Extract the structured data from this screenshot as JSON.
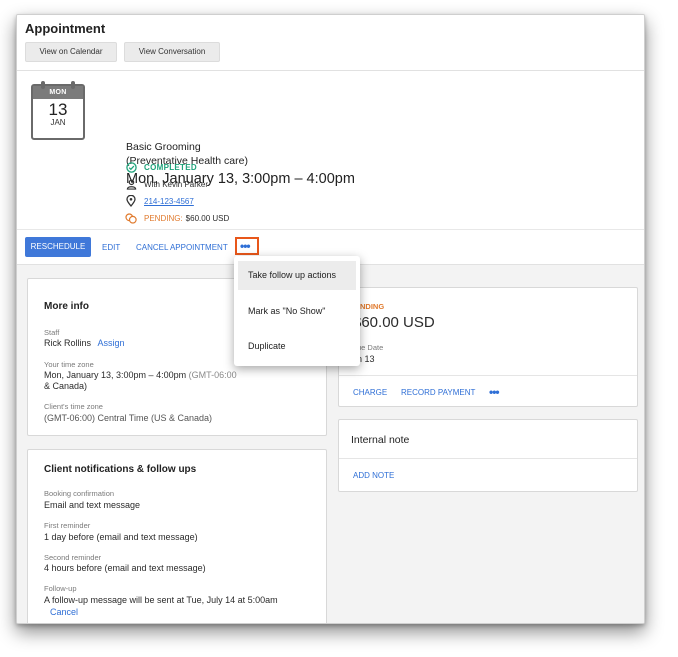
{
  "header": {
    "title": "Appointment",
    "view_calendar": "View on Calendar",
    "view_conversation": "View Conversation"
  },
  "calendar_icon": {
    "weekday": "MON",
    "day": "13",
    "month": "JAN"
  },
  "summary": {
    "service_line1": "Basic Grooming",
    "service_line2": "(Preventative Health care)",
    "datetime": "Mon, January 13, 3:00pm – 4:00pm",
    "status": "COMPLETED",
    "staff": "With Kevin Parker",
    "phone": "214-123-4567",
    "payment_status": "PENDING:",
    "payment_amount": "$60.00 USD"
  },
  "actions": {
    "reschedule": "RESCHEDULE",
    "edit": "EDIT",
    "cancel": "CANCEL APPOINTMENT",
    "more": "•••"
  },
  "more_menu": {
    "items": [
      "Take follow up actions",
      "Mark as \"No Show\"",
      "Duplicate"
    ]
  },
  "more_info": {
    "title": "More info",
    "staff_label": "Staff",
    "staff_value": "Rick Rollins",
    "assign": "Assign",
    "your_tz_label": "Your time zone",
    "your_tz_value": "Mon, January 13, 3:00pm – 4:00pm",
    "your_tz_zone_a": "(GMT-06:00",
    "your_tz_zone_b": "& Canada)",
    "client_tz_label": "Client's time zone",
    "client_tz_value": "(GMT-06:00) Central Time (US & Canada)"
  },
  "notifications": {
    "title": "Client notifications & follow ups",
    "booking_label": "Booking confirmation",
    "booking_value": "Email and text message",
    "first_label": "First reminder",
    "first_value": "1 day before (email and text message)",
    "second_label": "Second reminder",
    "second_value": "4 hours before (email and text message)",
    "followup_label": "Follow-up",
    "followup_value": "A follow-up message will be sent at Tue, July 14 at 5:00am",
    "cancel": "Cancel"
  },
  "payment_card": {
    "status": "ENDING",
    "amount": "$60.00 USD",
    "due_label": "ue Date",
    "due_value": "n 13",
    "charge": "CHARGE",
    "record": "RECORD PAYMENT",
    "more": "•••"
  },
  "internal_note": {
    "title": "Internal note",
    "add": "ADD NOTE"
  },
  "colors": {
    "accent": "#3f78d9",
    "link": "#2f6fd6",
    "completed": "#1fa27a",
    "pending": "#e07a2d",
    "highlight": "#e8571a"
  }
}
